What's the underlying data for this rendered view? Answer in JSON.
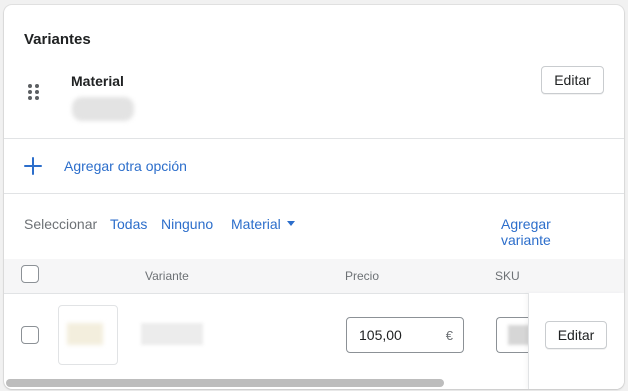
{
  "section": {
    "title": "Variantes"
  },
  "option": {
    "name": "Material",
    "edit_label": "Editar"
  },
  "add_option": {
    "label": "Agregar otra opción"
  },
  "selection": {
    "prefix": "Seleccionar",
    "all": "Todas",
    "none": "Ninguno",
    "filter": "Material",
    "add_variant": "Agregar variante"
  },
  "table": {
    "headers": {
      "variant": "Variante",
      "price": "Precio",
      "sku": "SKU"
    },
    "rows": [
      {
        "price": "105,00",
        "currency": "€",
        "edit_label": "Editar"
      }
    ]
  },
  "colors": {
    "link": "#2c6ecb",
    "border": "#e1e3e5",
    "text": "#202223"
  }
}
